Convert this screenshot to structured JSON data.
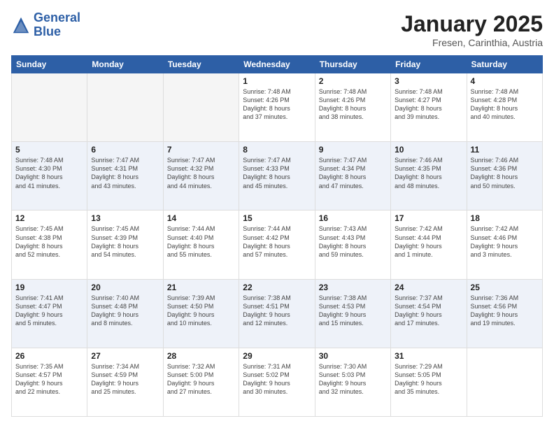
{
  "header": {
    "logo_line1": "General",
    "logo_line2": "Blue",
    "title": "January 2025",
    "location": "Fresen, Carinthia, Austria"
  },
  "days_of_week": [
    "Sunday",
    "Monday",
    "Tuesday",
    "Wednesday",
    "Thursday",
    "Friday",
    "Saturday"
  ],
  "weeks": [
    [
      {
        "day": "",
        "info": ""
      },
      {
        "day": "",
        "info": ""
      },
      {
        "day": "",
        "info": ""
      },
      {
        "day": "1",
        "info": "Sunrise: 7:48 AM\nSunset: 4:26 PM\nDaylight: 8 hours\nand 37 minutes."
      },
      {
        "day": "2",
        "info": "Sunrise: 7:48 AM\nSunset: 4:26 PM\nDaylight: 8 hours\nand 38 minutes."
      },
      {
        "day": "3",
        "info": "Sunrise: 7:48 AM\nSunset: 4:27 PM\nDaylight: 8 hours\nand 39 minutes."
      },
      {
        "day": "4",
        "info": "Sunrise: 7:48 AM\nSunset: 4:28 PM\nDaylight: 8 hours\nand 40 minutes."
      }
    ],
    [
      {
        "day": "5",
        "info": "Sunrise: 7:48 AM\nSunset: 4:30 PM\nDaylight: 8 hours\nand 41 minutes."
      },
      {
        "day": "6",
        "info": "Sunrise: 7:47 AM\nSunset: 4:31 PM\nDaylight: 8 hours\nand 43 minutes."
      },
      {
        "day": "7",
        "info": "Sunrise: 7:47 AM\nSunset: 4:32 PM\nDaylight: 8 hours\nand 44 minutes."
      },
      {
        "day": "8",
        "info": "Sunrise: 7:47 AM\nSunset: 4:33 PM\nDaylight: 8 hours\nand 45 minutes."
      },
      {
        "day": "9",
        "info": "Sunrise: 7:47 AM\nSunset: 4:34 PM\nDaylight: 8 hours\nand 47 minutes."
      },
      {
        "day": "10",
        "info": "Sunrise: 7:46 AM\nSunset: 4:35 PM\nDaylight: 8 hours\nand 48 minutes."
      },
      {
        "day": "11",
        "info": "Sunrise: 7:46 AM\nSunset: 4:36 PM\nDaylight: 8 hours\nand 50 minutes."
      }
    ],
    [
      {
        "day": "12",
        "info": "Sunrise: 7:45 AM\nSunset: 4:38 PM\nDaylight: 8 hours\nand 52 minutes."
      },
      {
        "day": "13",
        "info": "Sunrise: 7:45 AM\nSunset: 4:39 PM\nDaylight: 8 hours\nand 54 minutes."
      },
      {
        "day": "14",
        "info": "Sunrise: 7:44 AM\nSunset: 4:40 PM\nDaylight: 8 hours\nand 55 minutes."
      },
      {
        "day": "15",
        "info": "Sunrise: 7:44 AM\nSunset: 4:42 PM\nDaylight: 8 hours\nand 57 minutes."
      },
      {
        "day": "16",
        "info": "Sunrise: 7:43 AM\nSunset: 4:43 PM\nDaylight: 8 hours\nand 59 minutes."
      },
      {
        "day": "17",
        "info": "Sunrise: 7:42 AM\nSunset: 4:44 PM\nDaylight: 9 hours\nand 1 minute."
      },
      {
        "day": "18",
        "info": "Sunrise: 7:42 AM\nSunset: 4:46 PM\nDaylight: 9 hours\nand 3 minutes."
      }
    ],
    [
      {
        "day": "19",
        "info": "Sunrise: 7:41 AM\nSunset: 4:47 PM\nDaylight: 9 hours\nand 5 minutes."
      },
      {
        "day": "20",
        "info": "Sunrise: 7:40 AM\nSunset: 4:48 PM\nDaylight: 9 hours\nand 8 minutes."
      },
      {
        "day": "21",
        "info": "Sunrise: 7:39 AM\nSunset: 4:50 PM\nDaylight: 9 hours\nand 10 minutes."
      },
      {
        "day": "22",
        "info": "Sunrise: 7:38 AM\nSunset: 4:51 PM\nDaylight: 9 hours\nand 12 minutes."
      },
      {
        "day": "23",
        "info": "Sunrise: 7:38 AM\nSunset: 4:53 PM\nDaylight: 9 hours\nand 15 minutes."
      },
      {
        "day": "24",
        "info": "Sunrise: 7:37 AM\nSunset: 4:54 PM\nDaylight: 9 hours\nand 17 minutes."
      },
      {
        "day": "25",
        "info": "Sunrise: 7:36 AM\nSunset: 4:56 PM\nDaylight: 9 hours\nand 19 minutes."
      }
    ],
    [
      {
        "day": "26",
        "info": "Sunrise: 7:35 AM\nSunset: 4:57 PM\nDaylight: 9 hours\nand 22 minutes."
      },
      {
        "day": "27",
        "info": "Sunrise: 7:34 AM\nSunset: 4:59 PM\nDaylight: 9 hours\nand 25 minutes."
      },
      {
        "day": "28",
        "info": "Sunrise: 7:32 AM\nSunset: 5:00 PM\nDaylight: 9 hours\nand 27 minutes."
      },
      {
        "day": "29",
        "info": "Sunrise: 7:31 AM\nSunset: 5:02 PM\nDaylight: 9 hours\nand 30 minutes."
      },
      {
        "day": "30",
        "info": "Sunrise: 7:30 AM\nSunset: 5:03 PM\nDaylight: 9 hours\nand 32 minutes."
      },
      {
        "day": "31",
        "info": "Sunrise: 7:29 AM\nSunset: 5:05 PM\nDaylight: 9 hours\nand 35 minutes."
      },
      {
        "day": "",
        "info": ""
      }
    ]
  ]
}
